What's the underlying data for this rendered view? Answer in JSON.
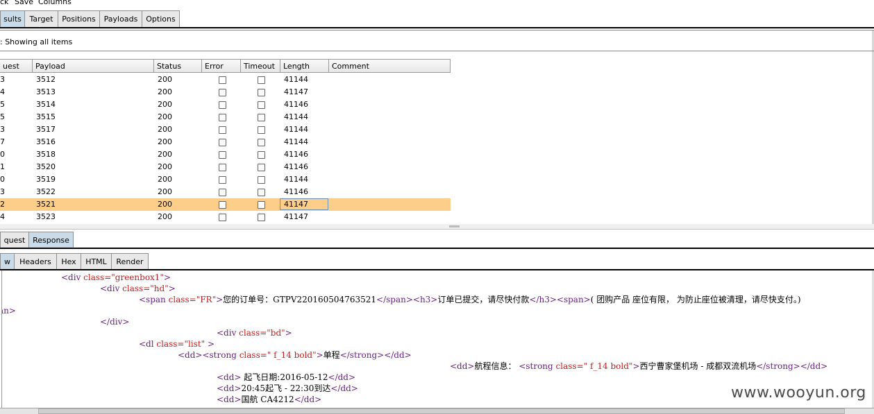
{
  "menubar": [
    "ck",
    "Save",
    "Columns"
  ],
  "top_tabs": [
    {
      "label": "sults",
      "active": true
    },
    {
      "label": "Target",
      "active": false
    },
    {
      "label": "Positions",
      "active": false
    },
    {
      "label": "Payloads",
      "active": false
    },
    {
      "label": "Options",
      "active": false
    }
  ],
  "filter_text": ": Showing all items",
  "table": {
    "headers": [
      "uest",
      "Payload",
      "Status",
      "Error",
      "Timeout",
      "Length",
      "Comment"
    ],
    "rows": [
      {
        "req": "3",
        "payload": "3512",
        "status": "200",
        "length": "41144",
        "selected": false
      },
      {
        "req": "4",
        "payload": "3513",
        "status": "200",
        "length": "41147",
        "selected": false
      },
      {
        "req": "5",
        "payload": "3514",
        "status": "200",
        "length": "41146",
        "selected": false
      },
      {
        "req": "5",
        "payload": "3515",
        "status": "200",
        "length": "41144",
        "selected": false
      },
      {
        "req": "3",
        "payload": "3517",
        "status": "200",
        "length": "41144",
        "selected": false
      },
      {
        "req": "7",
        "payload": "3516",
        "status": "200",
        "length": "41144",
        "selected": false
      },
      {
        "req": "0",
        "payload": "3518",
        "status": "200",
        "length": "41146",
        "selected": false
      },
      {
        "req": "1",
        "payload": "3520",
        "status": "200",
        "length": "41146",
        "selected": false
      },
      {
        "req": "0",
        "payload": "3519",
        "status": "200",
        "length": "41144",
        "selected": false
      },
      {
        "req": "3",
        "payload": "3522",
        "status": "200",
        "length": "41146",
        "selected": false
      },
      {
        "req": "2",
        "payload": "3521",
        "status": "200",
        "length": "41147",
        "selected": true
      },
      {
        "req": "4",
        "payload": "3523",
        "status": "200",
        "length": "41147",
        "selected": false
      }
    ]
  },
  "req_tabs": [
    {
      "label": "quest",
      "active": false
    },
    {
      "label": "Response",
      "active": true
    }
  ],
  "view_tabs": [
    {
      "label": "w",
      "active": true
    },
    {
      "label": "Headers",
      "active": false
    },
    {
      "label": "Hex",
      "active": false
    },
    {
      "label": "HTML",
      "active": false
    },
    {
      "label": "Render",
      "active": false
    }
  ],
  "code_lines": [
    [
      [
        "tg",
        "<div "
      ],
      [
        "an",
        "class="
      ],
      [
        "av",
        "\"greenbox1\""
      ],
      [
        "tg",
        ">"
      ]
    ],
    [
      [
        "tg",
        "<div "
      ],
      [
        "an",
        "class="
      ],
      [
        "av",
        "\"hd\""
      ],
      [
        "tg",
        ">"
      ]
    ],
    [
      [
        "tg",
        "<span "
      ],
      [
        "an",
        "class="
      ],
      [
        "av",
        "\"FR\""
      ],
      [
        "tg",
        ">"
      ],
      [
        "tx",
        "您的订单号：GTPV220160504763521"
      ],
      [
        "tg",
        "</span><h3>"
      ],
      [
        "tx",
        "订单已提交，请尽快付款"
      ],
      [
        "tg",
        "</h3><span>"
      ],
      [
        "tx",
        "( 团购产品 座位有限， 为防止座位被清理，请尽快支付。)"
      ]
    ],
    [
      [
        "tg",
        "an>"
      ]
    ],
    [
      [
        "tg",
        "</div>"
      ]
    ],
    [
      [
        "tg",
        "<div "
      ],
      [
        "an",
        "class="
      ],
      [
        "av",
        "\"bd\""
      ],
      [
        "tg",
        ">"
      ]
    ],
    [
      [
        "tg",
        "<dl "
      ],
      [
        "an",
        "class="
      ],
      [
        "av",
        "\"list\""
      ],
      [
        "tg",
        " >"
      ]
    ],
    [
      [
        "tg",
        "<dd><strong "
      ],
      [
        "an",
        "class="
      ],
      [
        "av",
        "\" f_14 bold\""
      ],
      [
        "tg",
        ">"
      ],
      [
        "tx",
        "单程"
      ],
      [
        "tg",
        "</strong></dd>"
      ]
    ],
    [
      [
        "tg",
        "<dd>"
      ],
      [
        "tx",
        "航程信息： "
      ],
      [
        "tg",
        "<strong "
      ],
      [
        "an",
        "class="
      ],
      [
        "av",
        "\" f_14 bold\""
      ],
      [
        "tg",
        ">"
      ],
      [
        "tx",
        "西宁曹家堡机场 - 成都双流机场"
      ],
      [
        "tg",
        "</strong></dd>"
      ]
    ],
    [
      [
        "tg",
        "<dd>"
      ],
      [
        "tx",
        " 起飞日期:2016-05-12"
      ],
      [
        "tg",
        "</dd>"
      ]
    ],
    [
      [
        "tg",
        "<dd>"
      ],
      [
        "tx",
        "20:45起飞 - 22:30到达"
      ],
      [
        "tg",
        "</dd>"
      ]
    ],
    [
      [
        "tg",
        "<dd>"
      ],
      [
        "tx",
        "国航 CA4212"
      ],
      [
        "tg",
        "</dd>"
      ]
    ]
  ],
  "watermark": "www.wooyun.org"
}
